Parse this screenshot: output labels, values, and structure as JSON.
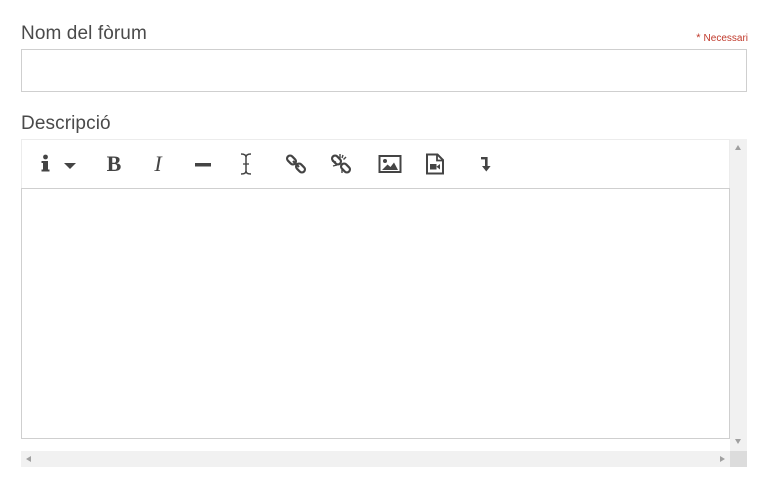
{
  "form": {
    "forum_name_label": "Nom del fòrum",
    "required_asterisk": "*",
    "required_label": "Necessari",
    "forum_name_value": "",
    "description_label": "Descripció"
  },
  "toolbar": {
    "buttons": [
      {
        "name": "info-dropdown-button",
        "icon": "info-icon"
      },
      {
        "name": "bold-button",
        "icon": "bold-icon",
        "glyph": "B"
      },
      {
        "name": "italic-button",
        "icon": "italic-icon",
        "glyph": "I"
      },
      {
        "name": "horizontal-rule-button",
        "icon": "horizontal-rule-icon"
      },
      {
        "name": "text-cursor-button",
        "icon": "text-cursor-icon"
      },
      {
        "name": "link-button",
        "icon": "link-icon"
      },
      {
        "name": "unlink-button",
        "icon": "unlink-icon"
      },
      {
        "name": "image-button",
        "icon": "image-icon"
      },
      {
        "name": "media-button",
        "icon": "video-file-icon"
      },
      {
        "name": "more-button",
        "icon": "arrow-down-icon"
      }
    ]
  },
  "colors": {
    "required": "#c0392b",
    "label": "#4a4a4a",
    "border": "#cfcfcf",
    "icon": "#444444"
  }
}
